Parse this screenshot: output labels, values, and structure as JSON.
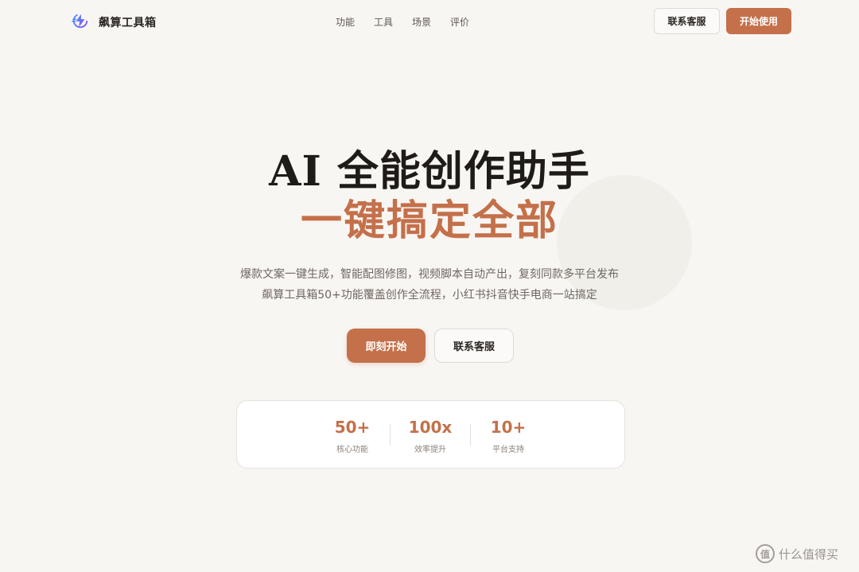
{
  "brand": {
    "name": "飙算工具箱",
    "icon": "lightning-logo-icon"
  },
  "nav": {
    "items": [
      "功能",
      "工具",
      "场景",
      "评价"
    ]
  },
  "header": {
    "contact_label": "联系客服",
    "start_label": "开始使用"
  },
  "hero": {
    "title": "AI 全能创作助手",
    "subtitle": "一键搞定全部",
    "desc_line1": "爆款文案一键生成，智能配图修图，视频脚本自动产出，复刻同款多平台发布",
    "desc_line2": "飙算工具箱50+功能覆盖创作全流程，小红书抖音快手电商一站搞定"
  },
  "cta": {
    "start_label": "即刻开始",
    "contact_label": "联系客服"
  },
  "stats": [
    {
      "value": "50+",
      "label": "核心功能"
    },
    {
      "value": "100x",
      "label": "效率提升"
    },
    {
      "value": "10+",
      "label": "平台支持"
    }
  ],
  "watermark": {
    "badge": "值",
    "text": "什么值得买"
  },
  "colors": {
    "accent": "#c4704a",
    "background": "#f8f6f3",
    "text": "#2b2622"
  }
}
